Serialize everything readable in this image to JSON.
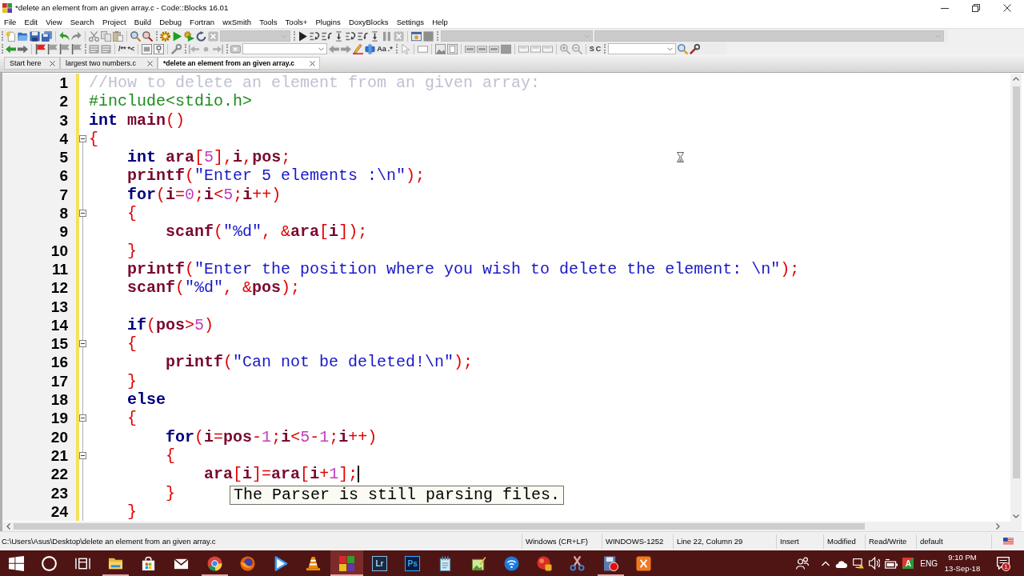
{
  "window": {
    "title": "*delete an element from an given array.c - Code::Blocks 16.01"
  },
  "menu": [
    "File",
    "Edit",
    "View",
    "Search",
    "Project",
    "Build",
    "Debug",
    "Fortran",
    "wxSmith",
    "Tools",
    "Tools+",
    "Plugins",
    "DoxyBlocks",
    "Settings",
    "Help"
  ],
  "toolbar": {
    "labels": [
      "/**",
      "*<",
      "Aa",
      ".*",
      "S",
      "C"
    ],
    "fields": [
      {
        "disabled": true
      },
      {
        "disabled": true
      },
      {
        "disabled": true
      },
      {
        "disabled": false
      },
      {
        "disabled": false
      }
    ]
  },
  "tabs": [
    {
      "label": "Start here",
      "selected": false
    },
    {
      "label": "largest two numbers.c",
      "selected": false
    },
    {
      "label": "*delete an element from an given array.c",
      "selected": true
    }
  ],
  "editor": {
    "lines": [
      {
        "number": "1",
        "changed": true,
        "foldable": false,
        "caret": false,
        "tokens": [
          {
            "kind": "comment",
            "text": "//How to delete an element from an given array:"
          }
        ]
      },
      {
        "number": "2",
        "changed": true,
        "foldable": false,
        "caret": false,
        "tokens": [
          {
            "kind": "preprocessor",
            "text": "#include<stdio.h>"
          }
        ]
      },
      {
        "number": "3",
        "changed": true,
        "foldable": false,
        "caret": false,
        "tokens": [
          {
            "kind": "keyword",
            "text": "int "
          },
          {
            "kind": "identifier",
            "text": "main"
          },
          {
            "kind": "operator",
            "text": "()"
          }
        ]
      },
      {
        "number": "4",
        "changed": true,
        "foldable": true,
        "caret": false,
        "tokens": [
          {
            "kind": "operator",
            "text": "{"
          }
        ]
      },
      {
        "number": "5",
        "changed": true,
        "foldable": false,
        "caret": false,
        "tokens": [
          {
            "kind": "keyword",
            "text": "    int "
          },
          {
            "kind": "identifier",
            "text": "ara"
          },
          {
            "kind": "operator",
            "text": "["
          },
          {
            "kind": "number",
            "text": "5"
          },
          {
            "kind": "operator",
            "text": "],"
          },
          {
            "kind": "identifier",
            "text": "i"
          },
          {
            "kind": "operator",
            "text": ","
          },
          {
            "kind": "identifier",
            "text": "pos"
          },
          {
            "kind": "operator",
            "text": ";"
          }
        ]
      },
      {
        "number": "6",
        "changed": true,
        "foldable": false,
        "caret": false,
        "tokens": [
          {
            "kind": "identifier",
            "text": "    printf"
          },
          {
            "kind": "operator",
            "text": "("
          },
          {
            "kind": "string",
            "text": "\"Enter 5 elements :\\n\""
          },
          {
            "kind": "operator",
            "text": ");"
          }
        ]
      },
      {
        "number": "7",
        "changed": true,
        "foldable": false,
        "caret": false,
        "tokens": [
          {
            "kind": "keyword",
            "text": "    for"
          },
          {
            "kind": "operator",
            "text": "("
          },
          {
            "kind": "identifier",
            "text": "i"
          },
          {
            "kind": "operator",
            "text": "="
          },
          {
            "kind": "number",
            "text": "0"
          },
          {
            "kind": "operator",
            "text": ";"
          },
          {
            "kind": "identifier",
            "text": "i"
          },
          {
            "kind": "operator",
            "text": "<"
          },
          {
            "kind": "number",
            "text": "5"
          },
          {
            "kind": "operator",
            "text": ";"
          },
          {
            "kind": "identifier",
            "text": "i"
          },
          {
            "kind": "operator",
            "text": "++)"
          }
        ]
      },
      {
        "number": "8",
        "changed": true,
        "foldable": true,
        "caret": false,
        "tokens": [
          {
            "kind": "operator",
            "text": "    {"
          }
        ]
      },
      {
        "number": "9",
        "changed": true,
        "foldable": false,
        "caret": false,
        "tokens": [
          {
            "kind": "identifier",
            "text": "        scanf"
          },
          {
            "kind": "operator",
            "text": "("
          },
          {
            "kind": "string",
            "text": "\"%d\""
          },
          {
            "kind": "operator",
            "text": ", &"
          },
          {
            "kind": "identifier",
            "text": "ara"
          },
          {
            "kind": "operator",
            "text": "["
          },
          {
            "kind": "identifier",
            "text": "i"
          },
          {
            "kind": "operator",
            "text": "]);"
          }
        ]
      },
      {
        "number": "10",
        "changed": true,
        "foldable": false,
        "caret": false,
        "tokens": [
          {
            "kind": "operator",
            "text": "    }"
          }
        ]
      },
      {
        "number": "11",
        "changed": true,
        "foldable": false,
        "caret": false,
        "tokens": [
          {
            "kind": "identifier",
            "text": "    printf"
          },
          {
            "kind": "operator",
            "text": "("
          },
          {
            "kind": "string",
            "text": "\"Enter the position where you wish to delete the element: \\n\""
          },
          {
            "kind": "operator",
            "text": ");"
          }
        ]
      },
      {
        "number": "12",
        "changed": true,
        "foldable": false,
        "caret": false,
        "tokens": [
          {
            "kind": "identifier",
            "text": "    scanf"
          },
          {
            "kind": "operator",
            "text": "("
          },
          {
            "kind": "string",
            "text": "\"%d\""
          },
          {
            "kind": "operator",
            "text": ", &"
          },
          {
            "kind": "identifier",
            "text": "pos"
          },
          {
            "kind": "operator",
            "text": ");"
          }
        ]
      },
      {
        "number": "13",
        "changed": true,
        "foldable": false,
        "caret": false
      },
      {
        "number": "14",
        "changed": true,
        "foldable": false,
        "caret": false,
        "tokens": [
          {
            "kind": "keyword",
            "text": "    if"
          },
          {
            "kind": "operator",
            "text": "("
          },
          {
            "kind": "identifier",
            "text": "pos"
          },
          {
            "kind": "operator",
            "text": ">"
          },
          {
            "kind": "number",
            "text": "5"
          },
          {
            "kind": "operator",
            "text": ")"
          }
        ]
      },
      {
        "number": "15",
        "changed": true,
        "foldable": true,
        "caret": false,
        "tokens": [
          {
            "kind": "operator",
            "text": "    {"
          }
        ]
      },
      {
        "number": "16",
        "changed": true,
        "foldable": false,
        "caret": false,
        "tokens": [
          {
            "kind": "identifier",
            "text": "        printf"
          },
          {
            "kind": "operator",
            "text": "("
          },
          {
            "kind": "string",
            "text": "\"Can not be deleted!\\n\""
          },
          {
            "kind": "operator",
            "text": ");"
          }
        ]
      },
      {
        "number": "17",
        "changed": true,
        "foldable": false,
        "caret": false,
        "tokens": [
          {
            "kind": "operator",
            "text": "    }"
          }
        ]
      },
      {
        "number": "18",
        "changed": true,
        "foldable": false,
        "caret": false,
        "tokens": [
          {
            "kind": "keyword",
            "text": "    else"
          }
        ]
      },
      {
        "number": "19",
        "changed": true,
        "foldable": true,
        "caret": false,
        "tokens": [
          {
            "kind": "operator",
            "text": "    {"
          }
        ]
      },
      {
        "number": "20",
        "changed": true,
        "foldable": false,
        "caret": false,
        "tokens": [
          {
            "kind": "keyword",
            "text": "        for"
          },
          {
            "kind": "operator",
            "text": "("
          },
          {
            "kind": "identifier",
            "text": "i"
          },
          {
            "kind": "operator",
            "text": "="
          },
          {
            "kind": "identifier",
            "text": "pos"
          },
          {
            "kind": "operator",
            "text": "-"
          },
          {
            "kind": "number",
            "text": "1"
          },
          {
            "kind": "operator",
            "text": ";"
          },
          {
            "kind": "identifier",
            "text": "i"
          },
          {
            "kind": "operator",
            "text": "<"
          },
          {
            "kind": "number",
            "text": "5"
          },
          {
            "kind": "operator",
            "text": "-"
          },
          {
            "kind": "number",
            "text": "1"
          },
          {
            "kind": "operator",
            "text": ";"
          },
          {
            "kind": "identifier",
            "text": "i"
          },
          {
            "kind": "operator",
            "text": "++)"
          }
        ]
      },
      {
        "number": "21",
        "changed": true,
        "foldable": true,
        "caret": false,
        "tokens": [
          {
            "kind": "operator",
            "text": "        {"
          }
        ]
      },
      {
        "number": "22",
        "changed": true,
        "foldable": false,
        "caret": true,
        "tokens": [
          {
            "kind": "identifier",
            "text": "            ara"
          },
          {
            "kind": "operator",
            "text": "["
          },
          {
            "kind": "identifier",
            "text": "i"
          },
          {
            "kind": "operator",
            "text": "]="
          },
          {
            "kind": "identifier",
            "text": "ara"
          },
          {
            "kind": "operator",
            "text": "["
          },
          {
            "kind": "identifier",
            "text": "i"
          },
          {
            "kind": "operator",
            "text": "+"
          },
          {
            "kind": "number",
            "text": "1"
          },
          {
            "kind": "operator",
            "text": "];"
          }
        ]
      },
      {
        "number": "23",
        "changed": true,
        "foldable": false,
        "caret": false,
        "tokens": [
          {
            "kind": "operator",
            "text": "        }"
          }
        ]
      },
      {
        "number": "24",
        "changed": true,
        "foldable": false,
        "caret": false,
        "tokens": [
          {
            "kind": "operator",
            "text": "    }"
          }
        ]
      }
    ],
    "tooltip": "The Parser is still parsing files."
  },
  "status_bar": {
    "path": "C:\\Users\\Asus\\Desktop\\delete an element from an given array.c",
    "fields": [
      "Windows (CR+LF)",
      "WINDOWS-1252",
      "Line 22, Column 29",
      "Insert",
      "Modified",
      "Read/Write",
      "default"
    ]
  },
  "taskbar": {
    "apps": [
      {
        "running": true,
        "selected": false
      },
      {
        "running": false,
        "selected": false
      },
      {
        "running": false,
        "selected": false
      },
      {
        "running": true,
        "selected": false
      },
      {
        "running": false,
        "selected": false
      },
      {
        "running": false,
        "selected": false
      },
      {
        "running": false,
        "selected": false
      },
      {
        "running": true,
        "selected": true
      },
      {
        "label": "Lr",
        "running": false,
        "selected": false
      },
      {
        "label": "Ps",
        "running": false,
        "selected": false
      },
      {
        "running": false,
        "selected": false
      },
      {
        "running": false,
        "selected": false
      },
      {
        "running": false,
        "selected": false
      },
      {
        "running": false,
        "selected": false
      },
      {
        "running": false,
        "selected": false
      },
      {
        "running": true,
        "selected": false
      },
      {
        "running": false,
        "selected": false
      }
    ],
    "tray": {
      "app_letter": "A",
      "language": "ENG",
      "time": "9:10 PM",
      "date": "13-Sep-18",
      "notification_count": "1"
    }
  }
}
